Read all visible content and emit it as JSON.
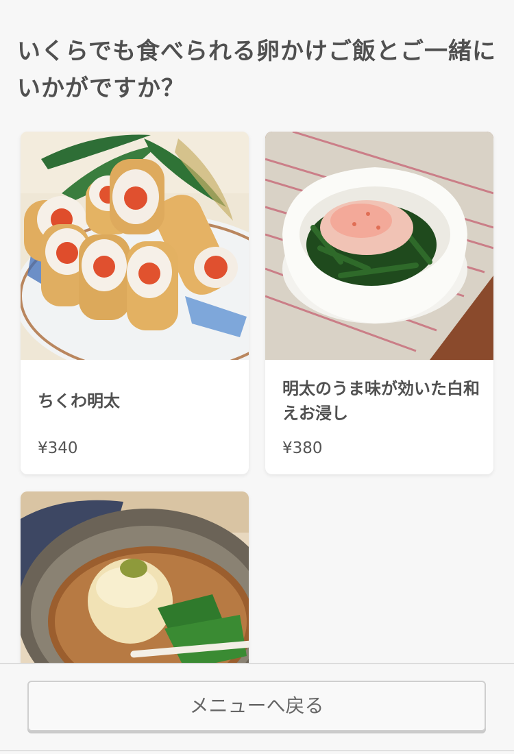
{
  "heading": "いくらでも食べられる卵かけご飯とご一緒にいかがですか？",
  "items": [
    {
      "name": "ちくわ明太",
      "price": "¥340",
      "photo": "chikuwa-mentai-photo"
    },
    {
      "name": "明太のうま味が効いた白和えお浸し",
      "price": "¥380",
      "photo": "spinach-shiraae-photo"
    },
    {
      "name": "",
      "price": "",
      "photo": "simmered-turnip-photo"
    }
  ],
  "footer": {
    "back_label": "メニューへ戻る"
  }
}
